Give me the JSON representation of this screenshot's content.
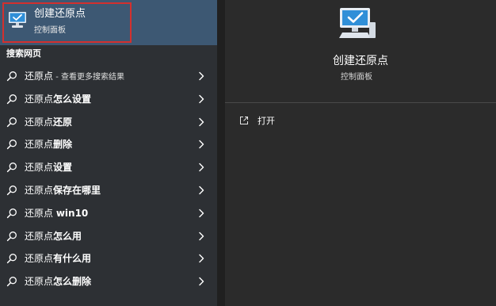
{
  "best_match": {
    "title": "创建还原点",
    "subtitle": "控制面板",
    "icon": "monitor-check-icon"
  },
  "web_section": {
    "header": "搜索网页"
  },
  "results": [
    {
      "base": "还原点",
      "bold": "",
      "hint": " - 查看更多搜索结果"
    },
    {
      "base": "还原点",
      "bold": "怎么设置",
      "hint": ""
    },
    {
      "base": "还原点",
      "bold": "还原",
      "hint": ""
    },
    {
      "base": "还原点",
      "bold": "删除",
      "hint": ""
    },
    {
      "base": "还原点",
      "bold": "设置",
      "hint": ""
    },
    {
      "base": "还原点",
      "bold": "保存在哪里",
      "hint": ""
    },
    {
      "base": "还原点 ",
      "bold": "win10",
      "hint": ""
    },
    {
      "base": "还原点",
      "bold": "怎么用",
      "hint": ""
    },
    {
      "base": "还原点",
      "bold": "有什么用",
      "hint": ""
    },
    {
      "base": "还原点",
      "bold": "怎么删除",
      "hint": ""
    }
  ],
  "detail": {
    "title": "创建还原点",
    "subtitle": "控制面板",
    "actions": [
      {
        "label": "打开",
        "icon": "open-external-icon"
      }
    ]
  },
  "colors": {
    "left_pane": "#2d3034",
    "right_pane": "#2b2b2b",
    "selected_row": "#3d5873",
    "highlight_border": "#d3302e"
  }
}
